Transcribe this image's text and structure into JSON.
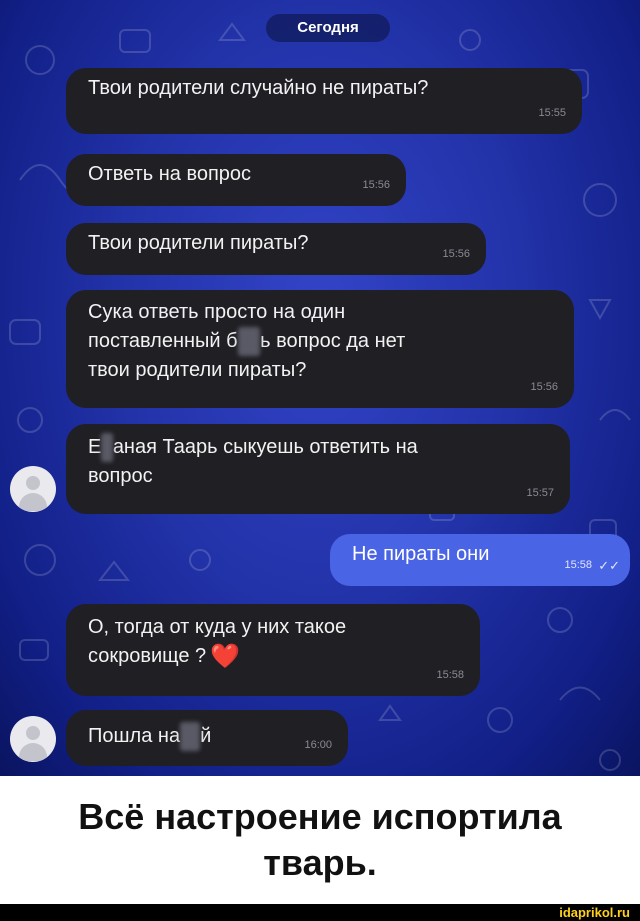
{
  "chat": {
    "date_label": "Сегодня",
    "messages": [
      {
        "text": "Твои родители случайно не пираты?",
        "time": "15:55",
        "direction": "in"
      },
      {
        "text": "Ответь на вопрос",
        "time": "15:56",
        "direction": "in"
      },
      {
        "text": "Твои родители пираты?",
        "time": "15:56",
        "direction": "in"
      },
      {
        "line1": "Сука ответь просто на один",
        "line2_pre": "поставленный б",
        "line2_censored": "ля",
        "line2_post": "ь вопрос да нет",
        "line3": "твои родители пираты?",
        "time": "15:56",
        "direction": "in"
      },
      {
        "pre": "Е",
        "censored": "б",
        "line1_post": "аная Таарь сыкуешь ответить на",
        "line2": "вопрос",
        "time": "15:57",
        "direction": "in"
      },
      {
        "text": "Не пираты они",
        "time": "15:58",
        "direction": "out",
        "status_icon": "double-check"
      },
      {
        "line1": "О, тогда от куда у них такое",
        "line2": "сокровище ?",
        "emoji": "❤️",
        "time": "15:58",
        "direction": "in"
      },
      {
        "pre": "Пошла на",
        "censored": "ху",
        "post": "й",
        "time": "16:00",
        "direction": "in"
      }
    ],
    "colors": {
      "incoming_bubble": "#1f1f24",
      "outgoing_bubble": "#4a64e6",
      "background": "#2232a8"
    }
  },
  "caption": {
    "line1": "Всё настроение испортила",
    "line2": "тварь."
  },
  "footer": {
    "site": "idaprikol.ru"
  }
}
